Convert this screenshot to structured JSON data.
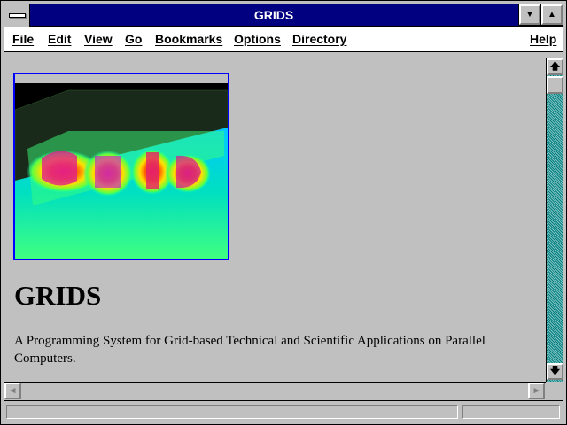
{
  "window": {
    "title": "GRIDS"
  },
  "menubar": {
    "items": [
      {
        "label": "File"
      },
      {
        "label": "Edit"
      },
      {
        "label": "View"
      },
      {
        "label": "Go"
      },
      {
        "label": "Bookmarks"
      },
      {
        "label": "Options"
      },
      {
        "label": "Directory"
      },
      {
        "label": "Help"
      }
    ]
  },
  "content": {
    "heading": "GRIDS",
    "description": "A Programming System for Grid-based Technical and Scientific Applications on Parallel Computers."
  },
  "icons": {
    "system_menu": "system-menu-icon",
    "minimize": "triangle-down-icon",
    "maximize": "triangle-up-icon",
    "scroll_up": "arrow-up-icon",
    "scroll_down": "arrow-down-icon",
    "scroll_left": "arrow-left-icon",
    "scroll_right": "arrow-right-icon"
  },
  "colors": {
    "titlebar": "#000080",
    "link_border": "#0000ff",
    "desktop": "#008080",
    "chrome": "#c0c0c0"
  },
  "status": {
    "text": ""
  }
}
